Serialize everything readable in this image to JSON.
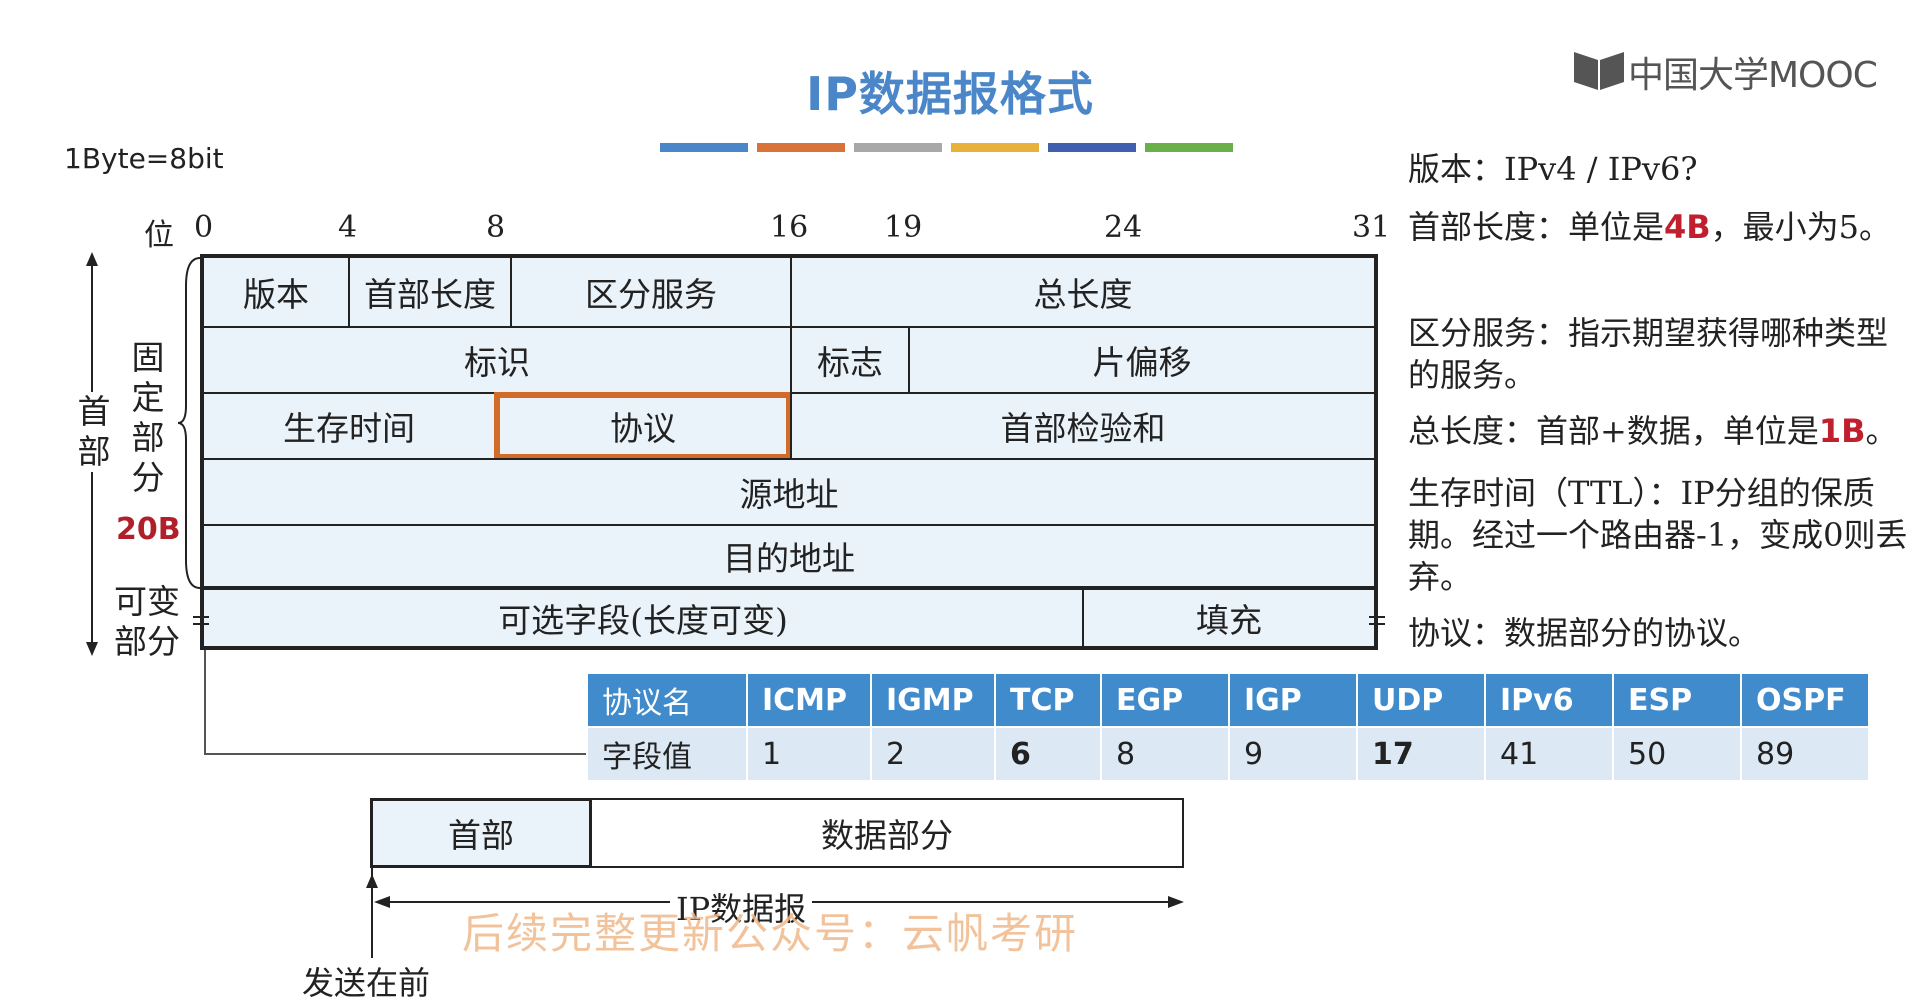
{
  "title": "IP数据报格式",
  "logo_text": "中国大学MOOC",
  "unit_note": "1Byte=8bit",
  "color_bars": [
    "#4a86c8",
    "#d9733a",
    "#a8a8a8",
    "#e8b23a",
    "#3f5fb0",
    "#6ab04a"
  ],
  "bit_positions": {
    "label": "位",
    "numbers": [
      "0",
      "4",
      "8",
      "16",
      "19",
      "24",
      "31"
    ]
  },
  "header_fields": {
    "version": "版本",
    "header_length": "首部长度",
    "diff_services": "区分服务",
    "total_length": "总长度",
    "identification": "标识",
    "flags": "标志",
    "fragment_offset": "片偏移",
    "ttl": "生存时间",
    "protocol": "协议",
    "checksum": "首部检验和",
    "src_addr": "源地址",
    "dst_addr": "目的地址",
    "options": "可选字段(长度可变)",
    "padding": "填充"
  },
  "side_labels": {
    "header": "首部",
    "fixed_part": "固定部分",
    "fixed_size": "20B",
    "variable_part_1": "可变",
    "variable_part_2": "部分"
  },
  "right_notes": {
    "version": "版本：IPv4 / IPv6?",
    "hl_prefix": "首部长度：单位是",
    "hl_unit": "4B",
    "hl_suffix": "，最小为5。",
    "ds": "区分服务：指示期望获得哪种类型的服务。",
    "tl_prefix": "总长度：首部+数据，单位是",
    "tl_unit": "1B",
    "tl_suffix": "。",
    "ttl": "生存时间（TTL）：IP分组的保质期。经过一个路由器-1，变成0则丢弃。",
    "proto": "协议：数据部分的协议。"
  },
  "protocol_table": {
    "header_label": "协议名",
    "value_label": "字段值",
    "names": [
      "ICMP",
      "IGMP",
      "TCP",
      "EGP",
      "IGP",
      "UDP",
      "IPv6",
      "ESP",
      "OSPF"
    ],
    "values": [
      "1",
      "2",
      "6",
      "8",
      "9",
      "17",
      "41",
      "50",
      "89"
    ]
  },
  "datagram": {
    "header": "首部",
    "data": "数据部分",
    "label": "IP数据报",
    "send_first": "发送在前"
  },
  "watermark": "后续完整更新公众号：云帆考研"
}
